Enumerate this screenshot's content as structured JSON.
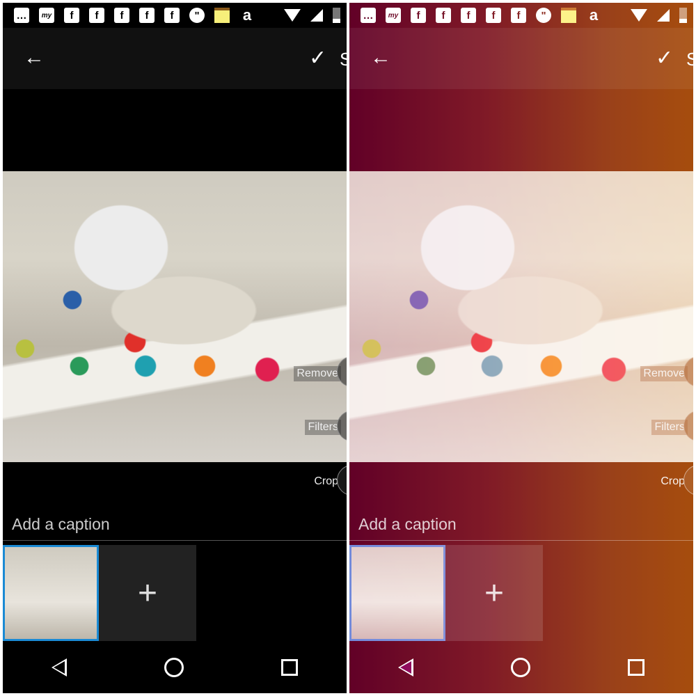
{
  "panels": [
    {
      "toolbar": {
        "back_icon": "←",
        "confirm_icon": "✓",
        "confirm_label": "S"
      },
      "actions": {
        "remove": "Remove",
        "filters": "Filters",
        "crop": "Crop"
      },
      "caption_placeholder": "Add a caption",
      "add_icon": "+",
      "filter": "none"
    },
    {
      "toolbar": {
        "back_icon": "←",
        "confirm_icon": "✓",
        "confirm_label": "S"
      },
      "actions": {
        "remove": "Remove",
        "filters": "Filters",
        "crop": "Crop"
      },
      "caption_placeholder": "Add a caption",
      "add_icon": "+",
      "filter": "warm red-orange gradient"
    }
  ],
  "status_icons": [
    "messages-icon",
    "myntra-icon",
    "facebook-icon",
    "facebook-icon",
    "facebook-icon",
    "facebook-icon",
    "facebook-icon",
    "hangouts-icon",
    "notes-icon",
    "amazon-icon",
    "wifi-icon",
    "signal-icon",
    "battery-icon"
  ],
  "colors": {
    "selected_thumb_border": "#1a8ad4"
  }
}
